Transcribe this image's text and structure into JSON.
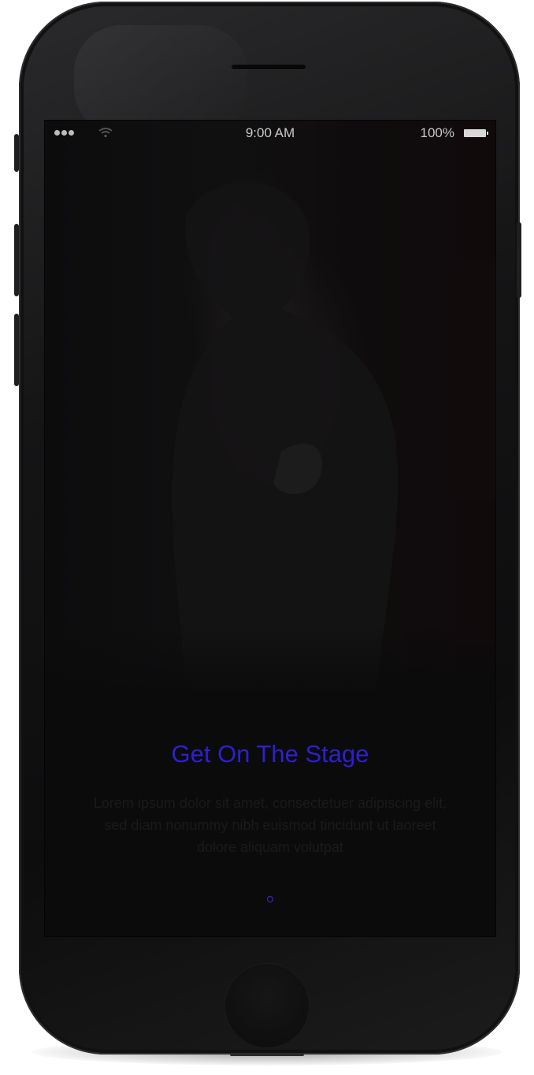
{
  "status_bar": {
    "time": "9:00 AM",
    "battery_percent": "100%",
    "signal_icon": "signal-dots-icon",
    "wifi_icon": "wifi-icon",
    "battery_icon": "battery-icon"
  },
  "onboarding": {
    "title": "Get On The Stage",
    "body": "Lorem ipsum dolor sit amet, consectetuer adipiscing elit, sed diam nonummy nibh euismod tincidunt ut laoreet dolore aliquam volutpat",
    "page_indicator_count": 1,
    "accent_color": "#2f1fd0"
  },
  "device": {
    "home_button_icon": "home-button-icon"
  }
}
